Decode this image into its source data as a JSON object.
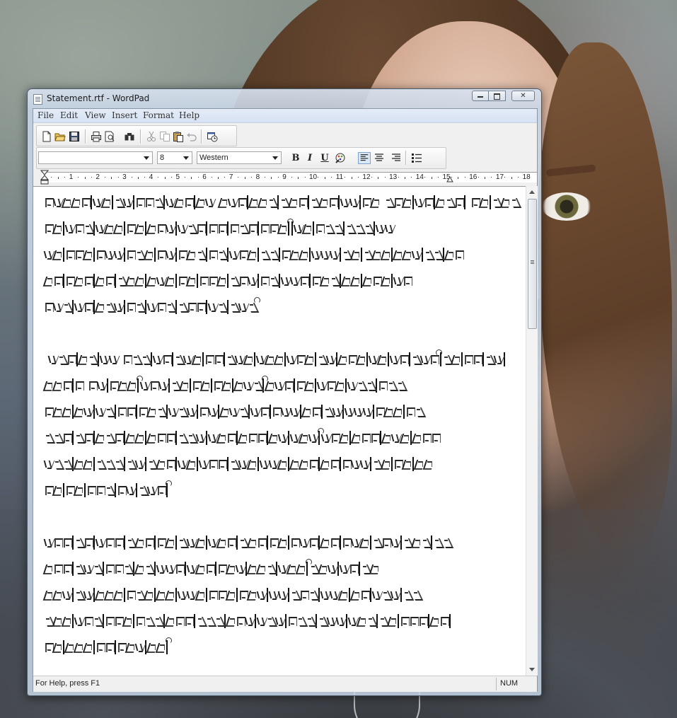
{
  "window": {
    "title": "Statement.rtf - WordPad",
    "controls": {
      "minimize": "minimize",
      "maximize": "maximize",
      "close": "close"
    }
  },
  "menubar": {
    "items": [
      "File",
      "Edit",
      "View",
      "Insert",
      "Format",
      "Help"
    ]
  },
  "toolbar": {
    "buttons": [
      "new-document-icon",
      "open-folder-icon",
      "save-disk-icon",
      "print-icon",
      "print-preview-icon",
      "find-binoculars-icon",
      "cut-scissors-icon",
      "copy-icon",
      "paste-icon",
      "undo-icon",
      "insert-datetime-icon"
    ]
  },
  "formatbar": {
    "font_name": "",
    "font_size": "8",
    "script": "Western",
    "bold_label": "B",
    "italic_label": "I",
    "underline_label": "U",
    "align_left_active": true
  },
  "ruler": {
    "labels": [
      "1",
      "2",
      "3",
      "4",
      "5",
      "6",
      "7",
      "8",
      "9",
      "10",
      "11",
      "12",
      "13",
      "14",
      "15",
      "16",
      "17",
      "18"
    ]
  },
  "document": {
    "lines": [
      [
        3,
        2,
        "|",
        2,
        "|",
        2,
        "|",
        3,
        "|",
        3,
        "|",
        2,
        " ",
        3,
        "|",
        3,
        "|",
        3,
        "|",
        3,
        "|",
        2,
        "|",
        2,
        " ",
        3,
        "|",
        2,
        "|",
        3,
        "|",
        " ",
        2,
        "|",
        3
      ],
      [
        2,
        "|",
        3,
        "|",
        3,
        "|",
        2,
        "|",
        3,
        "|",
        3,
        "|",
        2,
        "|",
        3,
        "|",
        3,
        "|",
        "~",
        "|",
        2,
        "|",
        3,
        "|",
        3,
        "|",
        2
      ],
      [
        2,
        "|",
        3,
        "|",
        3,
        "|",
        3,
        "|",
        2,
        "|",
        3,
        "|",
        2,
        "|",
        3,
        "|",
        2,
        "|",
        3,
        "|",
        3,
        "|",
        2,
        "|",
        3,
        "|",
        3,
        "|",
        2,
        "|",
        2
      ],
      [
        2,
        "|",
        3,
        "|",
        2,
        "|",
        3,
        "|",
        3,
        "|",
        2,
        "|",
        3,
        "|",
        3,
        "|",
        2,
        "|",
        3,
        "|",
        3,
        "|",
        2,
        "|",
        3,
        "|",
        2
      ],
      [
        3,
        "|",
        2,
        "|",
        3,
        "|",
        2,
        "|",
        3,
        "|",
        3,
        "|",
        2,
        "|",
        3,
        "~"
      ],
      [],
      [
        " ",
        3,
        "|",
        2,
        "|",
        2,
        " ",
        3,
        "|",
        2,
        "|",
        3,
        "|",
        2,
        "|",
        3,
        "|",
        3,
        "|",
        3,
        "|",
        2,
        "|",
        3,
        "|",
        2,
        "|",
        2,
        "|",
        3,
        "~",
        "|",
        2,
        "|",
        2,
        "|",
        2,
        "|"
      ],
      [
        3,
        "|",
        1,
        " ",
        2,
        "|",
        3,
        "|",
        "~",
        3,
        "|",
        2,
        "|",
        2,
        "|",
        2,
        "|",
        3,
        "|",
        "~",
        3,
        "|",
        2,
        "|",
        3,
        "|",
        3,
        "|",
        3
      ],
      [
        3,
        "|",
        2,
        "|",
        2,
        "|",
        2,
        "|",
        3,
        "|",
        3,
        "|",
        2,
        "|",
        3,
        "|",
        2,
        "|",
        3,
        "|",
        2,
        "|",
        2,
        "|",
        3,
        "|",
        3,
        "|",
        2
      ],
      [
        3,
        "|",
        2,
        "|",
        3,
        "|",
        2,
        "|",
        3,
        "|",
        3,
        "|",
        3,
        "|",
        3,
        "|",
        2,
        "|",
        3,
        "|",
        "~",
        3,
        "|",
        3,
        "|",
        3,
        "|",
        3
      ],
      [
        3,
        "|",
        2,
        "|",
        3,
        "|",
        2,
        "|",
        3,
        "|",
        2,
        "|",
        3,
        "|",
        3,
        "|",
        3,
        "|",
        3,
        "|",
        2,
        "|",
        3,
        "|",
        2,
        "|",
        2,
        "|",
        2
      ],
      [
        2,
        "|",
        2,
        "|",
        3,
        "|",
        2,
        "|",
        3,
        "|",
        "~"
      ],
      [],
      [
        3,
        "|",
        2,
        "|",
        3,
        "|",
        3,
        "|",
        2,
        "|",
        3,
        "|",
        3,
        "|",
        3,
        "|",
        2,
        "|",
        3,
        "|",
        2,
        "|",
        3,
        "|",
        3,
        "|",
        3,
        "|",
        2
      ],
      [
        3,
        "|",
        3,
        "|",
        3,
        "|",
        2,
        "|",
        3,
        "|",
        3,
        "|",
        3,
        "|",
        3,
        "|",
        3,
        "|",
        "~",
        3,
        "|",
        2,
        "|",
        2
      ],
      [
        3,
        "|",
        2,
        "|",
        3,
        "|",
        3,
        "|",
        2,
        "|",
        3,
        "|",
        3,
        "|",
        3,
        "|",
        2,
        "|",
        3,
        "|",
        3,
        "|",
        2,
        "|",
        3,
        "|",
        2
      ],
      [
        3,
        "|",
        3,
        "|",
        3,
        "|",
        3,
        "|",
        3,
        "|",
        3,
        "|",
        3,
        "|",
        3,
        "|",
        3,
        "|",
        3,
        "|",
        3,
        "|",
        2,
        "|",
        3,
        "|",
        2,
        "|"
      ],
      [
        2,
        "|",
        3,
        "|",
        2,
        "|",
        3,
        "|",
        2,
        "|",
        "~"
      ]
    ]
  },
  "statusbar": {
    "help_text": "For Help, press F1",
    "num_indicator": "NUM"
  }
}
